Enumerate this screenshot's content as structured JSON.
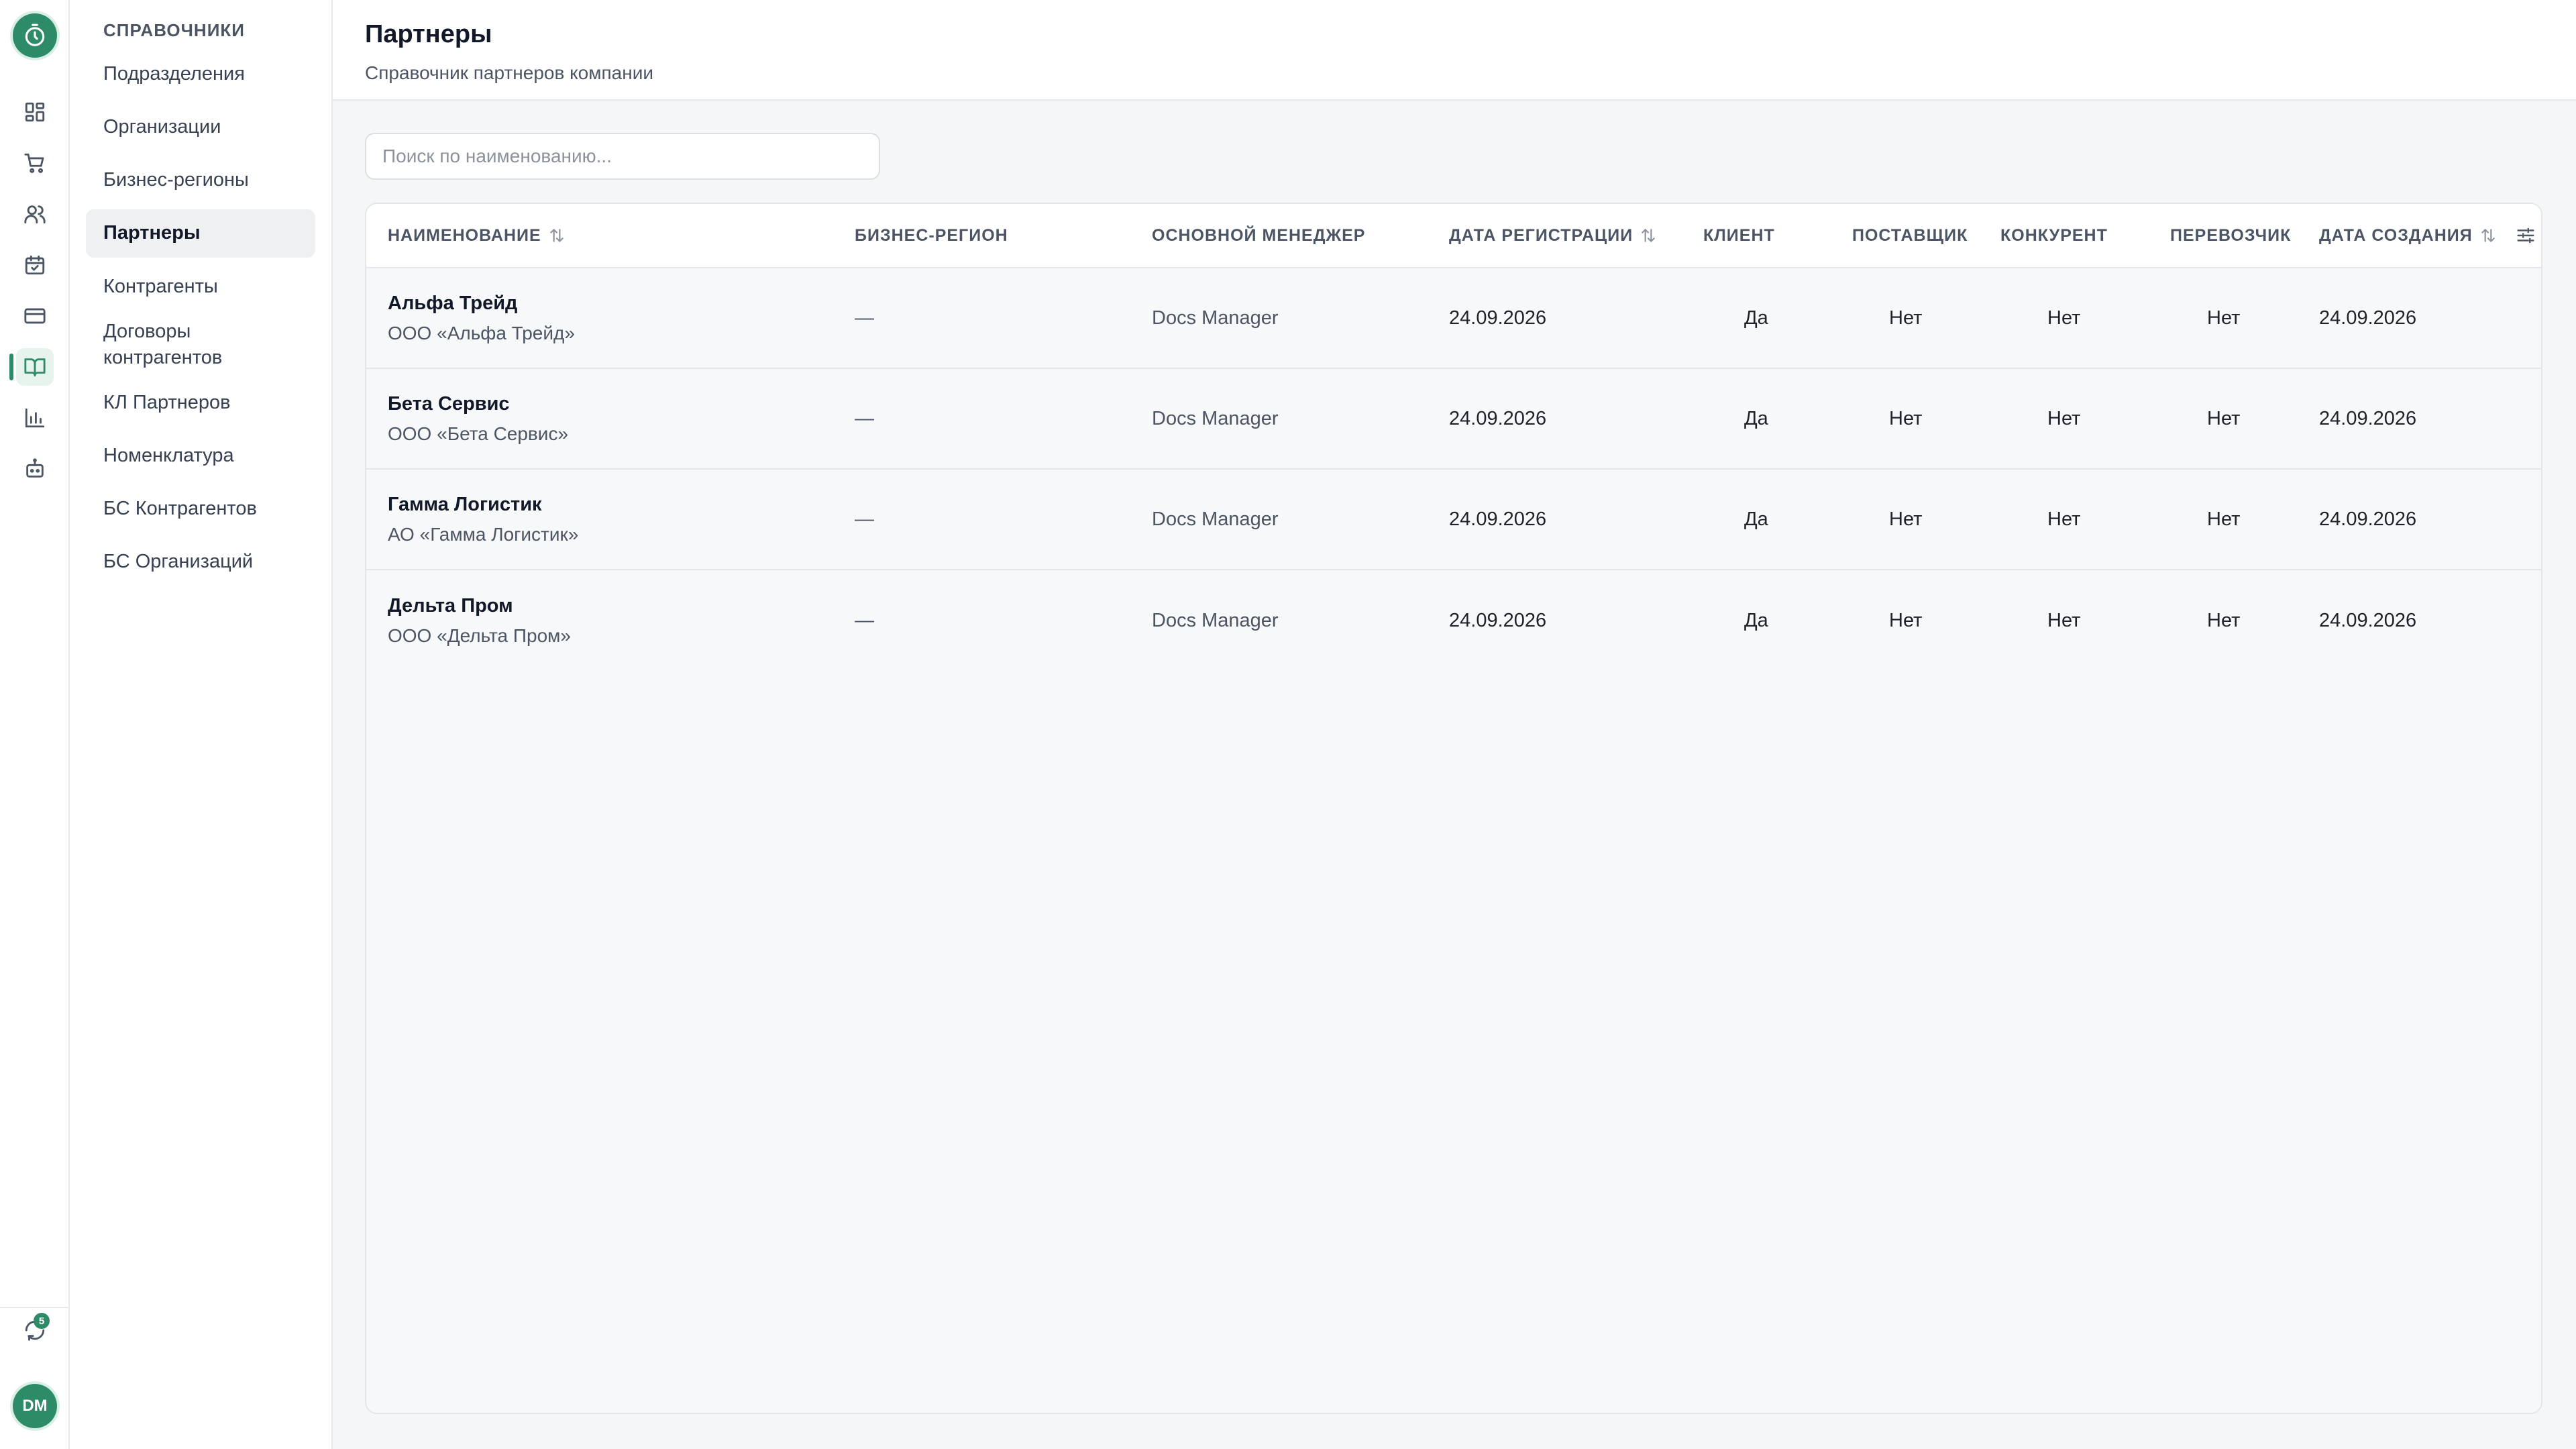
{
  "rail": {
    "logo_icon": "stopwatch-icon",
    "items": [
      {
        "icon": "dashboard-icon"
      },
      {
        "icon": "cart-icon"
      },
      {
        "icon": "users-icon"
      },
      {
        "icon": "calendar-icon"
      },
      {
        "icon": "card-icon"
      },
      {
        "icon": "book-icon",
        "active": true
      },
      {
        "icon": "chart-icon"
      },
      {
        "icon": "robot-icon"
      }
    ],
    "sync_badge": "5",
    "avatar": "DM",
    "accent": "#2e8b67"
  },
  "sidebar": {
    "heading": "СПРАВОЧНИКИ",
    "items": [
      {
        "label": "Подразделения"
      },
      {
        "label": "Организации"
      },
      {
        "label": "Бизнес-регионы"
      },
      {
        "label": "Партнеры",
        "active": true
      },
      {
        "label": "Контрагенты"
      },
      {
        "label": "Договоры контрагентов"
      },
      {
        "label": "КЛ Партнеров"
      },
      {
        "label": "Номенклатура"
      },
      {
        "label": "БС Контрагентов"
      },
      {
        "label": "БС Организаций"
      }
    ]
  },
  "header": {
    "title": "Партнеры",
    "subtitle": "Справочник партнеров компании"
  },
  "search": {
    "placeholder": "Поиск по наименованию..."
  },
  "table": {
    "columns": [
      {
        "label": "НАИМЕНОВАНИЕ",
        "sortable": true
      },
      {
        "label": "БИЗНЕС-РЕГИОН"
      },
      {
        "label": "ОСНОВНОЙ МЕНЕДЖЕР"
      },
      {
        "label": "ДАТА РЕГИСТРАЦИИ",
        "sortable": true
      },
      {
        "label": "КЛИЕНТ"
      },
      {
        "label": "ПОСТАВЩИК"
      },
      {
        "label": "КОНКУРЕНТ"
      },
      {
        "label": "ПЕРЕВОЗЧИК"
      },
      {
        "label": "ДАТА СОЗДАНИЯ",
        "sortable": true
      }
    ],
    "rows": [
      {
        "name": "Альфа Трейд",
        "legal": "ООО «Альфа Трейд»",
        "region": "—",
        "manager": "Docs Manager",
        "reg_date": "24.09.2026",
        "client": "Да",
        "supplier": "Нет",
        "competitor": "Нет",
        "carrier": "Нет",
        "created": "24.09.2026"
      },
      {
        "name": "Бета Сервис",
        "legal": "ООО «Бета Сервис»",
        "region": "—",
        "manager": "Docs Manager",
        "reg_date": "24.09.2026",
        "client": "Да",
        "supplier": "Нет",
        "competitor": "Нет",
        "carrier": "Нет",
        "created": "24.09.2026"
      },
      {
        "name": "Гамма Логистик",
        "legal": "АО «Гамма Логистик»",
        "region": "—",
        "manager": "Docs Manager",
        "reg_date": "24.09.2026",
        "client": "Да",
        "supplier": "Нет",
        "competitor": "Нет",
        "carrier": "Нет",
        "created": "24.09.2026"
      },
      {
        "name": "Дельта Пром",
        "legal": "ООО «Дельта Пром»",
        "region": "—",
        "manager": "Docs Manager",
        "reg_date": "24.09.2026",
        "client": "Да",
        "supplier": "Нет",
        "competitor": "Нет",
        "carrier": "Нет",
        "created": "24.09.2026"
      }
    ]
  }
}
